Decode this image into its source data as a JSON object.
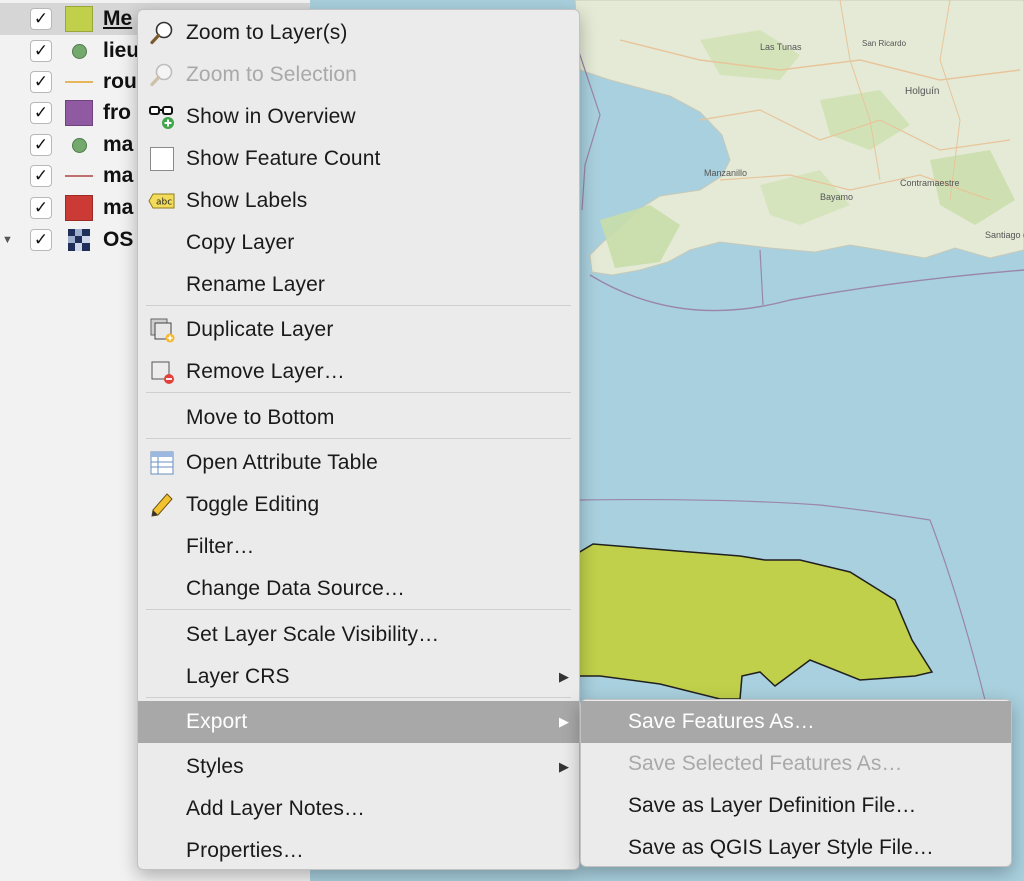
{
  "layers": [
    {
      "name": "Me",
      "symbol": "fill",
      "color": "#c0d04a",
      "checked": "✓",
      "selected": true
    },
    {
      "name": "lieu",
      "symbol": "point",
      "color": "#74a96e",
      "checked": "✓"
    },
    {
      "name": "rou",
      "symbol": "line",
      "color": "#e8b65a",
      "checked": "✓"
    },
    {
      "name": "fro",
      "symbol": "fill",
      "color": "#8f5aa2",
      "checked": "✓"
    },
    {
      "name": "ma",
      "symbol": "point",
      "color": "#74a96e",
      "checked": "✓"
    },
    {
      "name": "ma",
      "symbol": "line",
      "color": "#c0706a",
      "checked": "✓"
    },
    {
      "name": "ma",
      "symbol": "fill",
      "color": "#cc3a35",
      "checked": "✓"
    },
    {
      "name": "OS",
      "symbol": "raster",
      "checked": "✓",
      "expander": "▼"
    }
  ],
  "menu": {
    "items": [
      {
        "label": "Zoom to Layer(s)",
        "icon": "zoom-layer-icon"
      },
      {
        "label": "Zoom to Selection",
        "icon": "zoom-selection-icon",
        "disabled": true
      },
      {
        "label": "Show in Overview",
        "icon": "overview-glasses-icon"
      },
      {
        "label": "Show Feature Count",
        "icon": "checkbox-icon"
      },
      {
        "label": "Show Labels",
        "icon": "labels-abc-icon"
      },
      {
        "label": "Copy Layer"
      },
      {
        "label": "Rename Layer"
      },
      {
        "label": "Duplicate Layer",
        "icon": "duplicate-layer-icon"
      },
      {
        "label": "Remove Layer…",
        "icon": "remove-layer-icon"
      },
      {
        "label": "Move to Bottom"
      },
      {
        "label": "Open Attribute Table",
        "icon": "attribute-table-icon"
      },
      {
        "label": "Toggle Editing",
        "icon": "pencil-icon"
      },
      {
        "label": "Filter…"
      },
      {
        "label": "Change Data Source…"
      },
      {
        "label": "Set Layer Scale Visibility…"
      },
      {
        "label": "Layer CRS",
        "submenu": "▶"
      },
      {
        "label": "Export",
        "submenu": "▶",
        "highlighted": true
      },
      {
        "label": "Styles",
        "submenu": "▶"
      },
      {
        "label": "Add Layer Notes…"
      },
      {
        "label": "Properties…"
      }
    ]
  },
  "submenu": {
    "items": [
      {
        "label": "Save Features As…",
        "highlighted": true
      },
      {
        "label": "Save Selected Features As…",
        "disabled": true
      },
      {
        "label": "Save as Layer Definition File…"
      },
      {
        "label": "Save as QGIS Layer Style File…"
      }
    ]
  },
  "map": {
    "labels": [
      "Las Tunas",
      "San Ricardo",
      "Holguín",
      "Manzanillo",
      "Bayamo",
      "Contramaestre",
      "Santiago de Cuba"
    ],
    "colors": {
      "sea": "#a9d0de",
      "land": "#e6ebd8",
      "polygon": "#c0d04a"
    }
  }
}
